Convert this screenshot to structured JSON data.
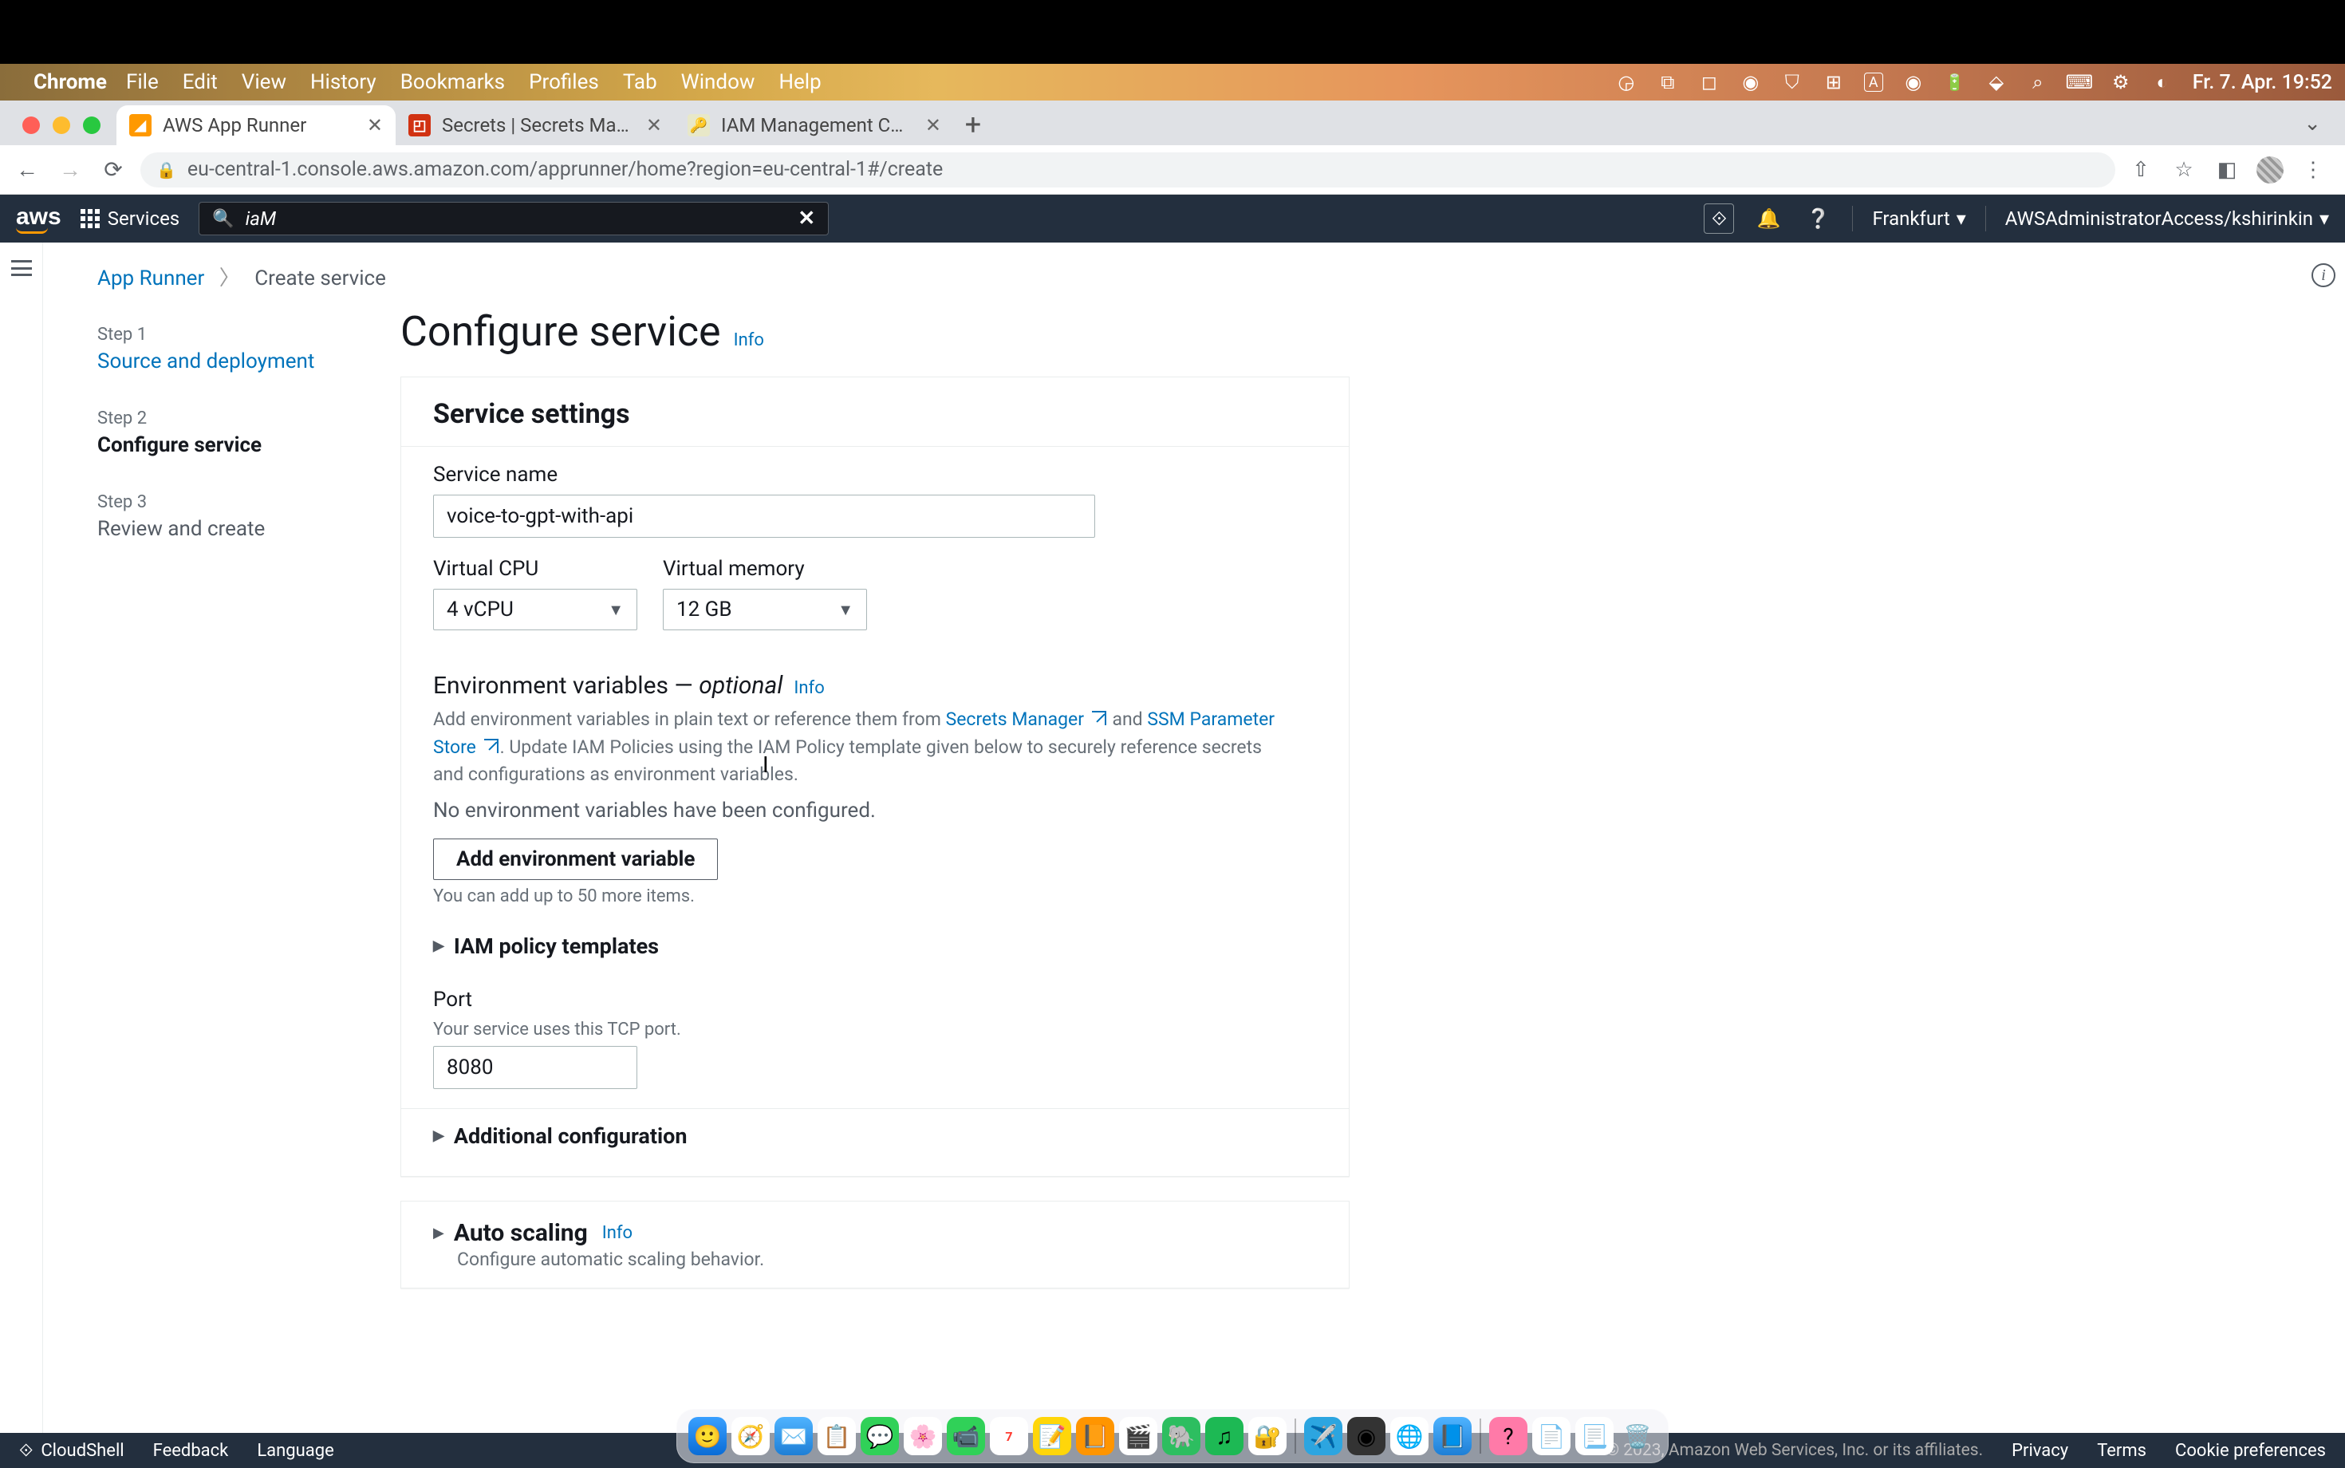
{
  "mac": {
    "app": "Chrome",
    "menus": [
      "File",
      "Edit",
      "View",
      "History",
      "Bookmarks",
      "Profiles",
      "Tab",
      "Window",
      "Help"
    ],
    "datetime": "Fr. 7. Apr.  19:52"
  },
  "tabs": [
    {
      "title": "AWS App Runner",
      "active": true,
      "favcolor": "#ff9900",
      "favtext": ""
    },
    {
      "title": "Secrets | Secrets Manager",
      "active": false,
      "favcolor": "#d13212",
      "favtext": ""
    },
    {
      "title": "IAM Management Console",
      "active": false,
      "favcolor": "#e8e8c8",
      "favtext": ""
    }
  ],
  "url": "eu-central-1.console.aws.amazon.com/apprunner/home?region=eu-central-1#/create",
  "aws": {
    "services": "Services",
    "search": "iaM",
    "region": "Frankfurt",
    "profile": "AWSAdministratorAccess/kshirinkin"
  },
  "breadcrumb": {
    "root": "App Runner",
    "current": "Create service"
  },
  "steps": [
    {
      "label": "Step 1",
      "title": "Source and deployment",
      "state": "link"
    },
    {
      "label": "Step 2",
      "title": "Configure service",
      "state": "active"
    },
    {
      "label": "Step 3",
      "title": "Review and create",
      "state": "pending"
    }
  ],
  "page": {
    "heading": "Configure service",
    "info": "Info",
    "serviceSettings": {
      "title": "Service settings",
      "serviceNameLabel": "Service name",
      "serviceNameValue": "voice-to-gpt-with-api",
      "vcpuLabel": "Virtual CPU",
      "vcpuValue": "4 vCPU",
      "vmemLabel": "Virtual memory",
      "vmemValue": "12 GB",
      "envTitle": "Environment variables — ",
      "envOptional": "optional",
      "envDesc1": "Add environment variables in plain text or reference them from ",
      "envLink1": "Secrets Manager",
      "envDescAnd": " and ",
      "envLink2": "SSM Parameter Store",
      "envDesc2": ". Update IAM Policies using the IAM Policy template given below to securely reference secrets and configurations as environment variables.",
      "envEmpty": "No environment variables have been configured.",
      "addEnvBtn": "Add environment variable",
      "addEnvHelp": "You can add up to 50 more items.",
      "iamTemplates": "IAM policy templates",
      "portLabel": "Port",
      "portHelp": "Your service uses this TCP port.",
      "portValue": "8080",
      "additionalConfig": "Additional configuration"
    },
    "autoScaling": {
      "title": "Auto scaling",
      "desc": "Configure automatic scaling behavior."
    }
  },
  "footer": {
    "cloudshell": "CloudShell",
    "feedback": "Feedback",
    "language": "Language",
    "copyright": "© 2023, Amazon Web Services, Inc. or its affiliates.",
    "privacy": "Privacy",
    "terms": "Terms",
    "cookies": "Cookie preferences"
  }
}
